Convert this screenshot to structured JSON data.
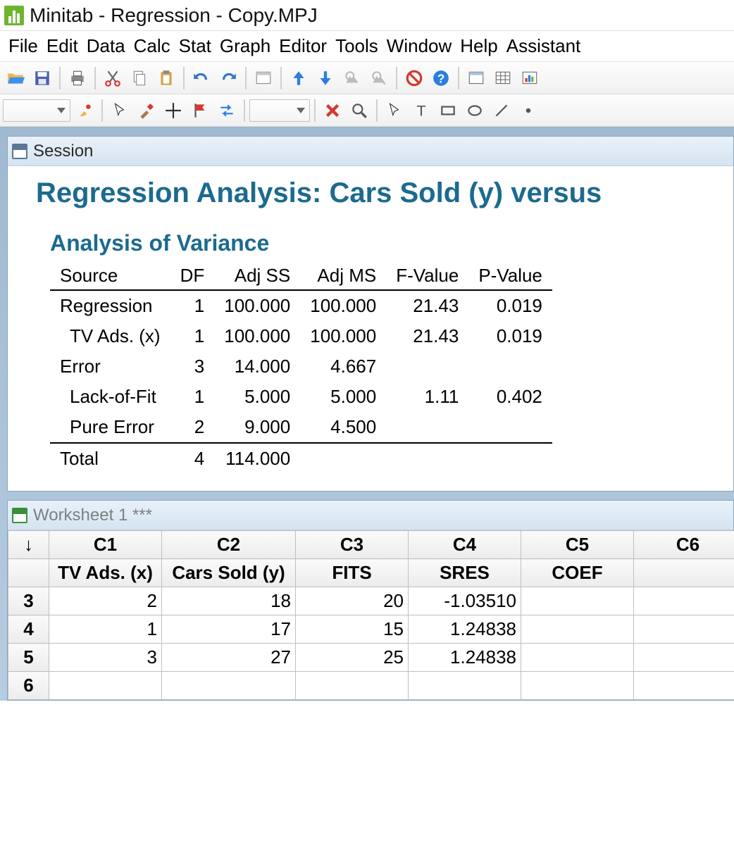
{
  "title": "Minitab - Regression - Copy.MPJ",
  "menu": [
    "File",
    "Edit",
    "Data",
    "Calc",
    "Stat",
    "Graph",
    "Editor",
    "Tools",
    "Window",
    "Help",
    "Assistant"
  ],
  "session": {
    "window_label": "Session",
    "report_title": "Regression Analysis: Cars Sold (y) versus ",
    "section_title": "Analysis of Variance",
    "anova_headers": [
      "Source",
      "DF",
      "Adj SS",
      "Adj MS",
      "F-Value",
      "P-Value"
    ],
    "anova_rows": [
      {
        "indent": 0,
        "cells": [
          "Regression",
          "1",
          "100.000",
          "100.000",
          "21.43",
          "0.019"
        ]
      },
      {
        "indent": 1,
        "cells": [
          "TV Ads. (x)",
          "1",
          "100.000",
          "100.000",
          "21.43",
          "0.019"
        ]
      },
      {
        "indent": 0,
        "cells": [
          "Error",
          "3",
          "14.000",
          "4.667",
          "",
          ""
        ]
      },
      {
        "indent": 1,
        "cells": [
          "Lack-of-Fit",
          "1",
          "5.000",
          "5.000",
          "1.11",
          "0.402"
        ]
      },
      {
        "indent": 1,
        "cells": [
          "Pure Error",
          "2",
          "9.000",
          "4.500",
          "",
          ""
        ]
      },
      {
        "indent": 0,
        "cells": [
          "Total",
          "4",
          "114.000",
          "",
          "",
          ""
        ]
      }
    ]
  },
  "worksheet": {
    "window_label": "Worksheet 1 ***",
    "col_ids": [
      "C1",
      "C2",
      "C3",
      "C4",
      "C5",
      "C6"
    ],
    "col_names": [
      "TV Ads. (x)",
      "Cars Sold (y)",
      "FITS",
      "SRES",
      "COEF",
      ""
    ],
    "rows": [
      {
        "n": "3",
        "cells": [
          "2",
          "18",
          "20",
          "-1.03510",
          "",
          ""
        ]
      },
      {
        "n": "4",
        "cells": [
          "1",
          "17",
          "15",
          "1.24838",
          "",
          ""
        ]
      },
      {
        "n": "5",
        "cells": [
          "3",
          "27",
          "25",
          "1.24838",
          "",
          ""
        ]
      },
      {
        "n": "6",
        "cells": [
          "",
          "",
          "",
          "",
          "",
          ""
        ]
      }
    ]
  },
  "chart_data": {
    "type": "table",
    "title": "Analysis of Variance",
    "columns": [
      "Source",
      "DF",
      "Adj SS",
      "Adj MS",
      "F-Value",
      "P-Value"
    ],
    "rows": [
      [
        "Regression",
        1,
        100.0,
        100.0,
        21.43,
        0.019
      ],
      [
        "TV Ads. (x)",
        1,
        100.0,
        100.0,
        21.43,
        0.019
      ],
      [
        "Error",
        3,
        14.0,
        4.667,
        null,
        null
      ],
      [
        "Lack-of-Fit",
        1,
        5.0,
        5.0,
        1.11,
        0.402
      ],
      [
        "Pure Error",
        2,
        9.0,
        4.5,
        null,
        null
      ],
      [
        "Total",
        4,
        114.0,
        null,
        null,
        null
      ]
    ]
  }
}
